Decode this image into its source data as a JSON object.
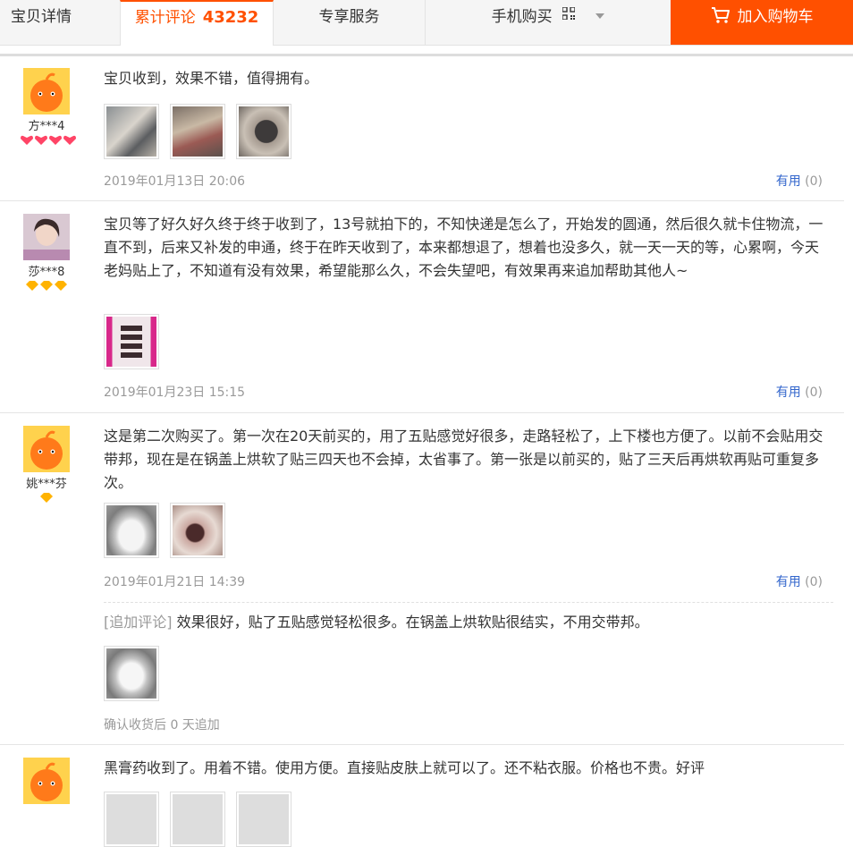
{
  "tabs": {
    "detail": "宝贝详情",
    "reviews_label": "累计评论",
    "reviews_count": "43232",
    "service": "专享服务",
    "mobile": "手机购买",
    "cart": "加入购物车"
  },
  "colors": {
    "accent": "#ff5000",
    "link": "#3366cc",
    "muted": "#999999"
  },
  "reviews": [
    {
      "user": "方***4",
      "rank_icons": "heart-gem x4",
      "text": "宝贝收到，效果不错，值得拥有。",
      "thumb_count": 3,
      "date": "2019年01月13日 20:06",
      "useful_label": "有用",
      "useful_count": "(0)"
    },
    {
      "user": "莎***8",
      "rank_icons": "diamond x3",
      "text": "宝贝等了好久好久终于终于收到了，13号就拍下的，不知快递是怎么了，开始发的圆通，然后很久就卡住物流，一直不到，后来又补发的申通，终于在昨天收到了，本来都想退了，想着也没多久，就一天一天的等，心累啊，今天老妈贴上了，不知道有没有效果，希望能那么久，不会失望吧，有效果再来追加帮助其他人~",
      "thumb_count": 1,
      "date": "2019年01月23日 15:15",
      "useful_label": "有用",
      "useful_count": "(0)"
    },
    {
      "user": "姚***芬",
      "rank_icons": "diamond x1",
      "text": "这是第二次购买了。第一次在20天前买的，用了五贴感觉好很多，走路轻松了，上下楼也方便了。以前不会贴用交带邦，现在是在锅盖上烘软了贴三四天也不会掉，太省事了。第一张是以前买的，贴了三天后再烘软再贴可重复多次。",
      "thumb_count": 2,
      "date": "2019年01月21日 14:39",
      "useful_label": "有用",
      "useful_count": "(0)",
      "append_tag": "[追加评论]",
      "append_text": "效果很好，贴了五贴感觉轻松很多。在锅盖上烘软贴很结实，不用交带邦。",
      "append_after": "确认收货后 0 天追加"
    },
    {
      "user": "",
      "text": "黑膏药收到了。用着不错。使用方便。直接贴皮肤上就可以了。还不粘衣服。价格也不贵。好评"
    }
  ]
}
